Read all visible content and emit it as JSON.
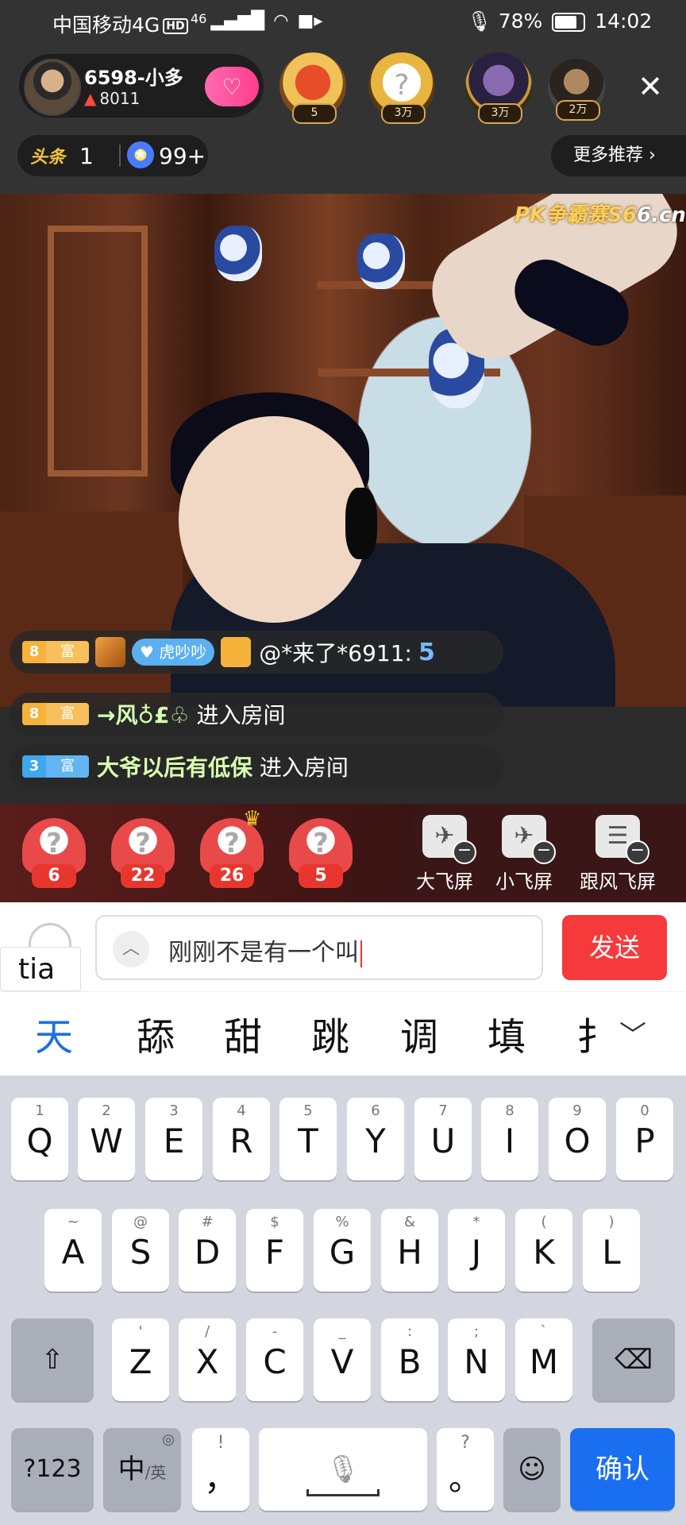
{
  "status_bar": {
    "carrier": "中国移动4G",
    "hd": "HD",
    "network": "46",
    "battery": "78%",
    "time": "14:02"
  },
  "host": {
    "name": "6598-小多",
    "heat": "8011"
  },
  "top_fans": [
    {
      "tag": "5"
    },
    {
      "tag": "3万"
    },
    {
      "tag": "3万"
    },
    {
      "tag": "2万"
    }
  ],
  "rank": {
    "toutiao_label": "头条",
    "toutiao_count": "1",
    "star_count": "99+"
  },
  "more_recommend": "更多推荐 ›",
  "watermark": {
    "brand": "PK争霸赛S6",
    "site": "6.cn"
  },
  "chat": [
    {
      "level": "8",
      "level_tag": "富",
      "tag": "虎吵吵",
      "text": "@*来了*6911:",
      "v": "5"
    },
    {
      "level": "8",
      "level_tag": "富",
      "user": "→风♁£♧",
      "text": "进入房间"
    },
    {
      "level": "3",
      "level_tag": "富",
      "user": "大爷以后有低保",
      "text": "进入房间"
    }
  ],
  "gifts": [
    {
      "count": "6"
    },
    {
      "count": "22"
    },
    {
      "count": "26"
    },
    {
      "count": "5"
    }
  ],
  "fly_buttons": [
    {
      "label": "大飞屏"
    },
    {
      "label": "小飞屏"
    },
    {
      "label": "跟风飞屏"
    }
  ],
  "input": {
    "pinyin": "tia",
    "text": "刚刚不是有一个叫",
    "send": "发送"
  },
  "candidates": [
    "天",
    "舔",
    "甜",
    "跳",
    "调",
    "填",
    "扌"
  ],
  "keyboard": {
    "row1": [
      {
        "hint": "1",
        "key": "Q"
      },
      {
        "hint": "2",
        "key": "W"
      },
      {
        "hint": "3",
        "key": "E"
      },
      {
        "hint": "4",
        "key": "R"
      },
      {
        "hint": "5",
        "key": "T"
      },
      {
        "hint": "6",
        "key": "Y"
      },
      {
        "hint": "7",
        "key": "U"
      },
      {
        "hint": "8",
        "key": "I"
      },
      {
        "hint": "9",
        "key": "O"
      },
      {
        "hint": "0",
        "key": "P"
      }
    ],
    "row2": [
      {
        "hint": "~",
        "key": "A"
      },
      {
        "hint": "@",
        "key": "S"
      },
      {
        "hint": "#",
        "key": "D"
      },
      {
        "hint": "$",
        "key": "F"
      },
      {
        "hint": "%",
        "key": "G"
      },
      {
        "hint": "&",
        "key": "H"
      },
      {
        "hint": "*",
        "key": "J"
      },
      {
        "hint": "(",
        "key": "K"
      },
      {
        "hint": ")",
        "key": "L"
      }
    ],
    "row3": [
      {
        "hint": "'",
        "key": "Z"
      },
      {
        "hint": "/",
        "key": "X"
      },
      {
        "hint": "-",
        "key": "C"
      },
      {
        "hint": "_",
        "key": "V"
      },
      {
        "hint": ":",
        "key": "B"
      },
      {
        "hint": ";",
        "key": "N"
      },
      {
        "hint": "`",
        "key": "M"
      }
    ],
    "mode_num": "?123",
    "mode_lang": "中",
    "mode_lang_alt": "/英",
    "comma_hint": "!",
    "comma": "，",
    "period_hint": "?",
    "period": "。",
    "confirm": "确认"
  }
}
